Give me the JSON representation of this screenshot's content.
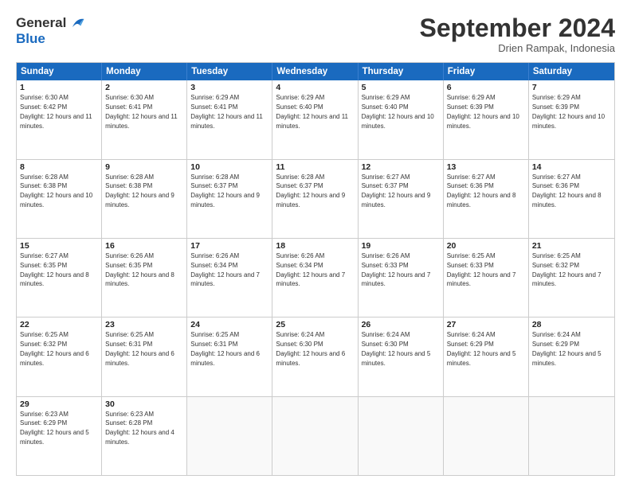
{
  "logo": {
    "line1": "General",
    "line2": "Blue"
  },
  "header": {
    "month": "September 2024",
    "location": "Drien Rampak, Indonesia"
  },
  "days": [
    "Sunday",
    "Monday",
    "Tuesday",
    "Wednesday",
    "Thursday",
    "Friday",
    "Saturday"
  ],
  "rows": [
    [
      {
        "day": "1",
        "rise": "6:30 AM",
        "set": "6:42 PM",
        "daylight": "12 hours and 11 minutes."
      },
      {
        "day": "2",
        "rise": "6:30 AM",
        "set": "6:41 PM",
        "daylight": "12 hours and 11 minutes."
      },
      {
        "day": "3",
        "rise": "6:29 AM",
        "set": "6:41 PM",
        "daylight": "12 hours and 11 minutes."
      },
      {
        "day": "4",
        "rise": "6:29 AM",
        "set": "6:40 PM",
        "daylight": "12 hours and 11 minutes."
      },
      {
        "day": "5",
        "rise": "6:29 AM",
        "set": "6:40 PM",
        "daylight": "12 hours and 10 minutes."
      },
      {
        "day": "6",
        "rise": "6:29 AM",
        "set": "6:39 PM",
        "daylight": "12 hours and 10 minutes."
      },
      {
        "day": "7",
        "rise": "6:29 AM",
        "set": "6:39 PM",
        "daylight": "12 hours and 10 minutes."
      }
    ],
    [
      {
        "day": "8",
        "rise": "6:28 AM",
        "set": "6:38 PM",
        "daylight": "12 hours and 10 minutes."
      },
      {
        "day": "9",
        "rise": "6:28 AM",
        "set": "6:38 PM",
        "daylight": "12 hours and 9 minutes."
      },
      {
        "day": "10",
        "rise": "6:28 AM",
        "set": "6:37 PM",
        "daylight": "12 hours and 9 minutes."
      },
      {
        "day": "11",
        "rise": "6:28 AM",
        "set": "6:37 PM",
        "daylight": "12 hours and 9 minutes."
      },
      {
        "day": "12",
        "rise": "6:27 AM",
        "set": "6:37 PM",
        "daylight": "12 hours and 9 minutes."
      },
      {
        "day": "13",
        "rise": "6:27 AM",
        "set": "6:36 PM",
        "daylight": "12 hours and 8 minutes."
      },
      {
        "day": "14",
        "rise": "6:27 AM",
        "set": "6:36 PM",
        "daylight": "12 hours and 8 minutes."
      }
    ],
    [
      {
        "day": "15",
        "rise": "6:27 AM",
        "set": "6:35 PM",
        "daylight": "12 hours and 8 minutes."
      },
      {
        "day": "16",
        "rise": "6:26 AM",
        "set": "6:35 PM",
        "daylight": "12 hours and 8 minutes."
      },
      {
        "day": "17",
        "rise": "6:26 AM",
        "set": "6:34 PM",
        "daylight": "12 hours and 7 minutes."
      },
      {
        "day": "18",
        "rise": "6:26 AM",
        "set": "6:34 PM",
        "daylight": "12 hours and 7 minutes."
      },
      {
        "day": "19",
        "rise": "6:26 AM",
        "set": "6:33 PM",
        "daylight": "12 hours and 7 minutes."
      },
      {
        "day": "20",
        "rise": "6:25 AM",
        "set": "6:33 PM",
        "daylight": "12 hours and 7 minutes."
      },
      {
        "day": "21",
        "rise": "6:25 AM",
        "set": "6:32 PM",
        "daylight": "12 hours and 7 minutes."
      }
    ],
    [
      {
        "day": "22",
        "rise": "6:25 AM",
        "set": "6:32 PM",
        "daylight": "12 hours and 6 minutes."
      },
      {
        "day": "23",
        "rise": "6:25 AM",
        "set": "6:31 PM",
        "daylight": "12 hours and 6 minutes."
      },
      {
        "day": "24",
        "rise": "6:25 AM",
        "set": "6:31 PM",
        "daylight": "12 hours and 6 minutes."
      },
      {
        "day": "25",
        "rise": "6:24 AM",
        "set": "6:30 PM",
        "daylight": "12 hours and 6 minutes."
      },
      {
        "day": "26",
        "rise": "6:24 AM",
        "set": "6:30 PM",
        "daylight": "12 hours and 5 minutes."
      },
      {
        "day": "27",
        "rise": "6:24 AM",
        "set": "6:29 PM",
        "daylight": "12 hours and 5 minutes."
      },
      {
        "day": "28",
        "rise": "6:24 AM",
        "set": "6:29 PM",
        "daylight": "12 hours and 5 minutes."
      }
    ],
    [
      {
        "day": "29",
        "rise": "6:23 AM",
        "set": "6:29 PM",
        "daylight": "12 hours and 5 minutes."
      },
      {
        "day": "30",
        "rise": "6:23 AM",
        "set": "6:28 PM",
        "daylight": "12 hours and 4 minutes."
      },
      null,
      null,
      null,
      null,
      null
    ]
  ]
}
